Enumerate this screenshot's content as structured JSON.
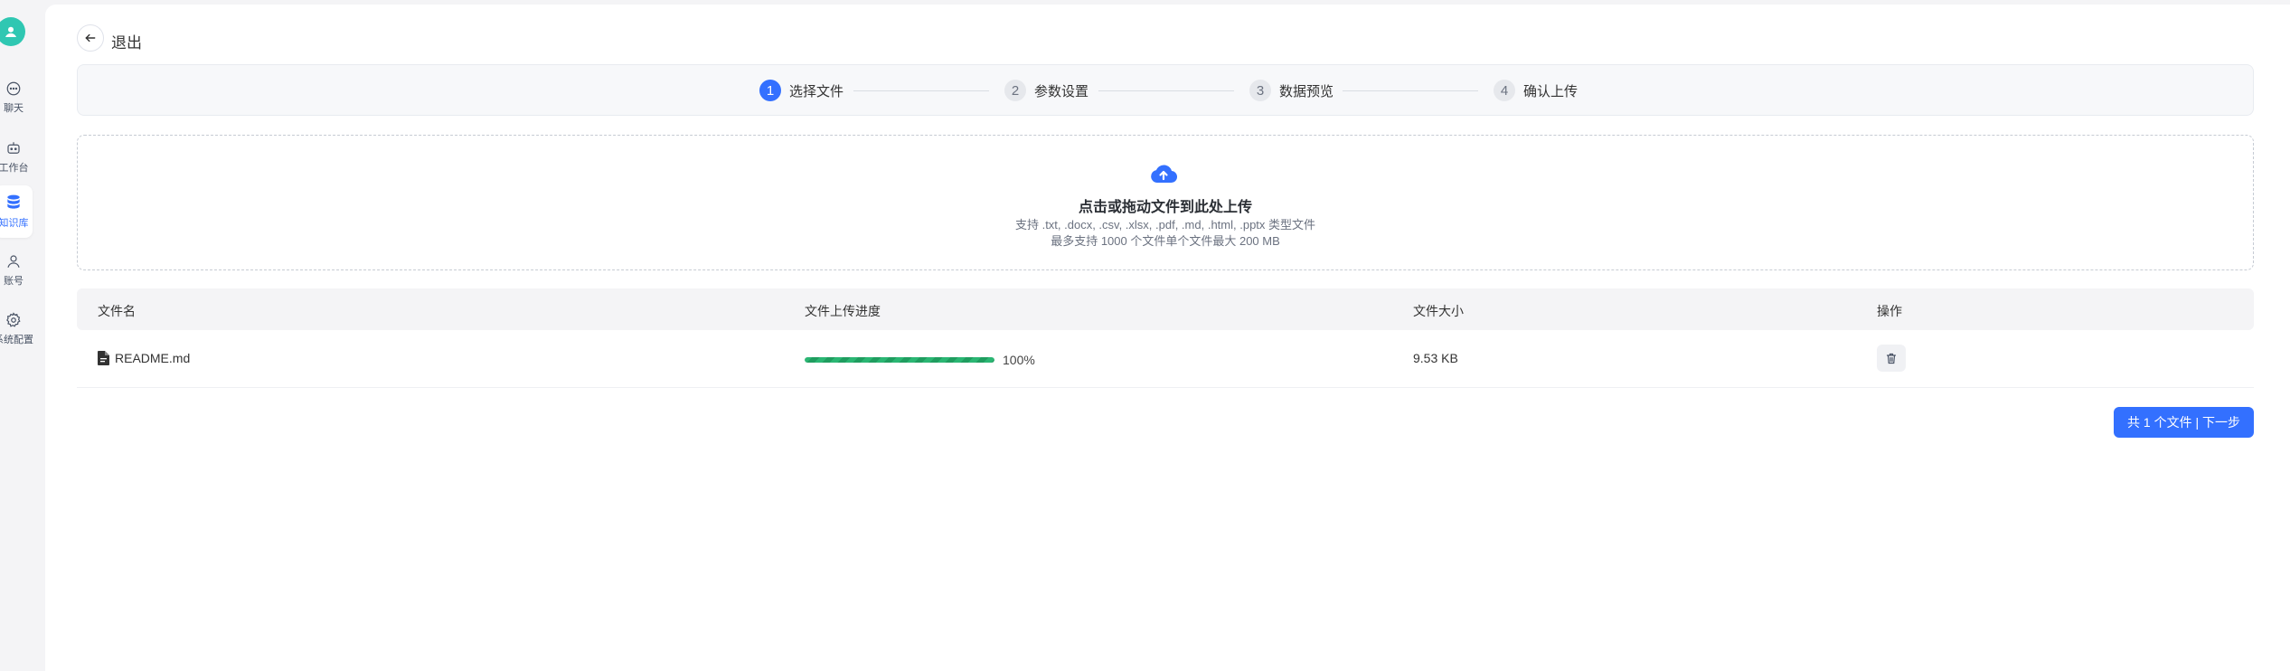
{
  "sidebar": {
    "items": [
      {
        "label": "聊天",
        "icon": "chat-icon"
      },
      {
        "label": "工作台",
        "icon": "robot-icon"
      },
      {
        "label": "知识库",
        "icon": "database-icon",
        "active": true
      },
      {
        "label": "账号",
        "icon": "user-icon"
      },
      {
        "label": "系统配置",
        "icon": "gear-icon"
      }
    ]
  },
  "header": {
    "exit_label": "退出"
  },
  "steps": [
    {
      "num": "1",
      "label": "选择文件",
      "active": true
    },
    {
      "num": "2",
      "label": "参数设置"
    },
    {
      "num": "3",
      "label": "数据预览"
    },
    {
      "num": "4",
      "label": "确认上传"
    }
  ],
  "upload": {
    "title": "点击或拖动文件到此处上传",
    "supported": "支持 .txt, .docx, .csv, .xlsx, .pdf, .md, .html, .pptx 类型文件",
    "limits": "最多支持 1000 个文件单个文件最大 200 MB"
  },
  "table": {
    "headers": {
      "name": "文件名",
      "progress": "文件上传进度",
      "size": "文件大小",
      "actions": "操作"
    },
    "rows": [
      {
        "name": "README.md",
        "progress": 1.0,
        "progress_text": "100%",
        "size": "9.53 KB"
      }
    ]
  },
  "next_button": "共 1 个文件 | 下一步",
  "colors": {
    "accent": "#3370ff",
    "success": "#2bb673",
    "avatar": "#2fc7b2"
  }
}
